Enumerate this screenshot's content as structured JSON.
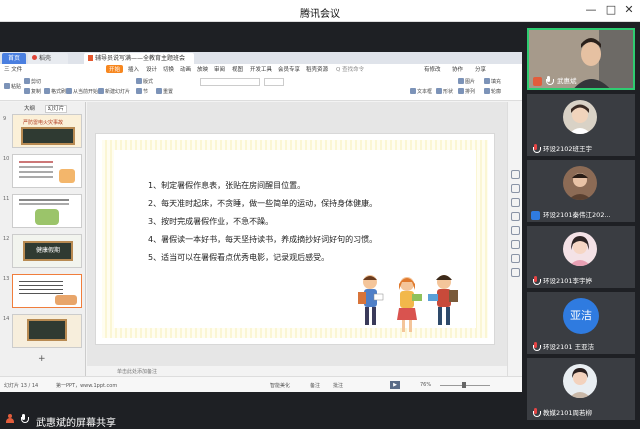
{
  "window": {
    "title": "腾讯会议",
    "controls": [
      "—",
      "□",
      "✕"
    ]
  },
  "wps": {
    "tabs": [
      {
        "label": "首页"
      },
      {
        "label": "稻壳"
      },
      {
        "label": "辅导员说写满——全教育主题班会"
      }
    ],
    "menu": [
      "三 文件",
      "开始",
      "插入",
      "设计",
      "切换",
      "动画",
      "放映",
      "审阅",
      "视图",
      "开发工具",
      "会员专享",
      "稻壳资源",
      "Q 查找命令"
    ],
    "menu_right": [
      "有修改",
      "协作",
      "分享"
    ],
    "toolbar": [
      "粘贴",
      "剪切",
      "复制",
      "格式刷",
      "从当前开始",
      "新建幻灯片",
      "版式",
      "节",
      "重置",
      "文本框",
      "形状",
      "排列",
      "图片",
      "填充",
      "轮廓"
    ],
    "panel_tabs": [
      "大纲",
      "幻灯片"
    ],
    "thumbnails": [
      {
        "num": "9",
        "title": "严防雷电火灾事故"
      },
      {
        "num": "10",
        "title": ""
      },
      {
        "num": "11",
        "title": ""
      },
      {
        "num": "12",
        "title": "健康假期"
      },
      {
        "num": "13",
        "title": ""
      },
      {
        "num": "14",
        "title": ""
      }
    ],
    "slide_lines": [
      "1、制定暑假作息表，张贴在房间醒目位置。",
      "2、每天准时起床，不贪睡，做一些简单的运动，保持身体健康。",
      "3、按时完成暑假作业，不急不躁。",
      "4、暑假读一本好书，每天坚持读书，养成摘抄好词好句的习惯。",
      "5、适当可以在暑假看点优秀电影，记录观后感受。"
    ],
    "notes_placeholder": "单击此处添加备注",
    "status": {
      "slide_info": "幻灯片 13 / 14",
      "theme": "第一PPT，www.1ppt.com",
      "smart": "智能美化",
      "notes": "备注",
      "comments": "批注",
      "zoom": "76%"
    }
  },
  "share_label": "武惠斌的屏幕共享",
  "participants": [
    {
      "name": "武惠斌",
      "type": "video"
    },
    {
      "name": "环设2102班王宇",
      "type": "photo"
    },
    {
      "name": "环设2101秦伟江202...",
      "type": "photo"
    },
    {
      "name": "环设2101李宇婷",
      "type": "photo"
    },
    {
      "name": "环设2101 王亚洁",
      "type": "text",
      "avatar_text": "亚洁"
    },
    {
      "name": "教媒2101周若柳",
      "type": "photo"
    }
  ],
  "colors": {
    "accent_orange": "#f7871f",
    "meeting_blue": "#2f7be0",
    "speaking_green": "#2ecc71"
  }
}
